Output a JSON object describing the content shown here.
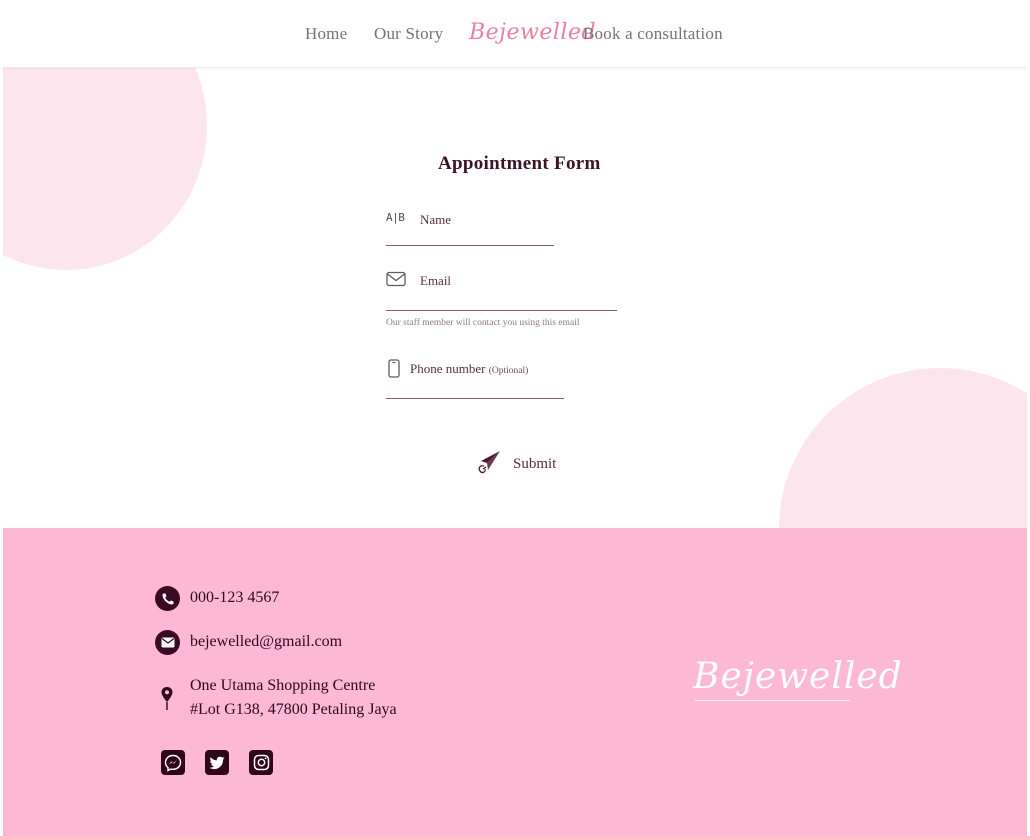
{
  "nav": {
    "home": "Home",
    "story": "Our Story",
    "logo": "Bejewelled",
    "book": "Book a consultation"
  },
  "form": {
    "title": "Appointment Form",
    "name_icon": "A|B",
    "name_label": "Name",
    "email_label": "Email",
    "email_hint": "Our staff member will contact you using this email",
    "phone_label": "Phone number",
    "phone_optional": "(Optional)",
    "submit_label": "Submit"
  },
  "footer": {
    "phone": "000-123 4567",
    "email": "bejewelled@gmail.com",
    "address_line1": "One Utama Shopping Centre",
    "address_line2": "#Lot G138, 47800 Petaling Jaya",
    "logo": "Bejewelled"
  },
  "icons": {
    "name": "text-field-icon",
    "email": "envelope-icon",
    "phone": "mobile-phone-icon",
    "submit": "paper-plane-icon",
    "footer_phone": "phone-icon",
    "footer_email": "mail-icon",
    "footer_address": "location-pin-icon",
    "socials": [
      "messenger-icon",
      "twitter-icon",
      "instagram-icon"
    ]
  },
  "colors": {
    "accent_pink": "#e97fa4",
    "footer_bg": "#fdb8d3",
    "circle": "#fce5ec",
    "dark": "#3a0a22"
  }
}
